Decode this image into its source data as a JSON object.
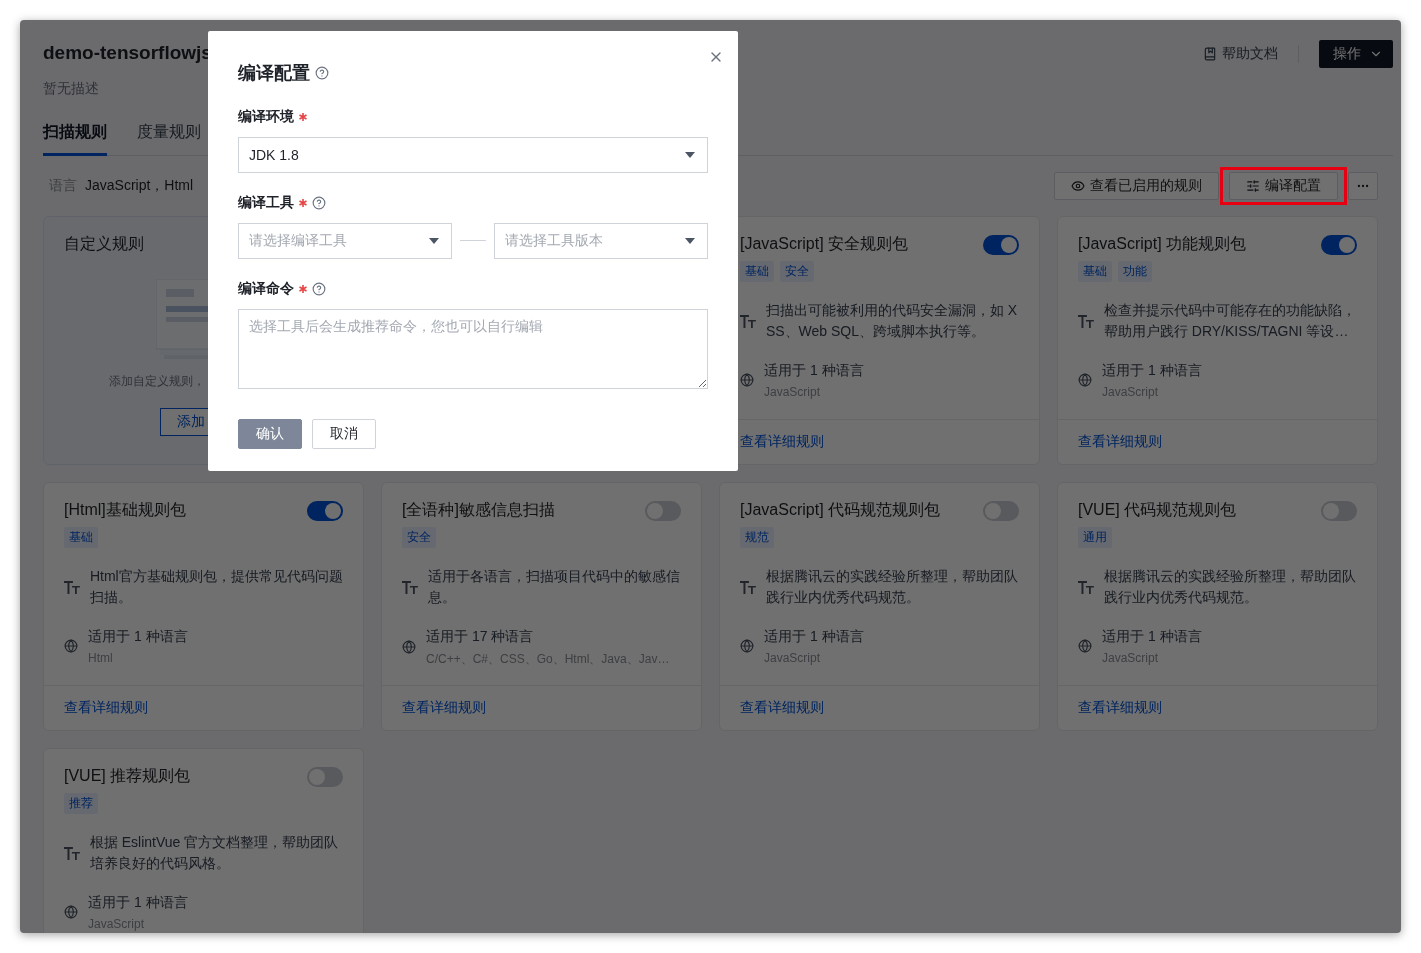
{
  "header": {
    "title": "demo-tensorflowjs",
    "description": "暂无描述",
    "help_link": "帮助文档",
    "actions_button": "操作"
  },
  "tabs": [
    {
      "label": "扫描规则",
      "selected": true
    },
    {
      "label": "度量规则",
      "selected": false
    }
  ],
  "languages": {
    "label": "语言",
    "value": "JavaScript，Html"
  },
  "toolbar": {
    "buttons": [
      {
        "kind": "view",
        "label": "查看已启用的规则",
        "highlighted": false
      },
      {
        "kind": "config",
        "label": "编译配置",
        "highlighted": true
      },
      {
        "kind": "more",
        "highlighted": false
      }
    ]
  },
  "custom_card": {
    "title": "自定义规则",
    "hint": "添加自定义规则，",
    "button": "添加"
  },
  "cards": [
    {
      "title": "[JavaScript] 安全规则包",
      "enabled": true,
      "tags": [
        "基础",
        "安全"
      ],
      "description": "扫描出可能被利用的代码安全漏洞，如 XSS、Web SQL、跨域脚本执行等。",
      "language_count": "适用于 1 种语言",
      "languages": "JavaScript",
      "link": "查看详细规则"
    },
    {
      "title": "[JavaScript] 功能规则包",
      "enabled": true,
      "tags": [
        "基础",
        "功能"
      ],
      "description": "检查并提示代码中可能存在的功能缺陷，帮助用户践行 DRY/KISS/TAGNI 等设…",
      "language_count": "适用于 1 种语言",
      "languages": "JavaScript",
      "link": "查看详细规则"
    },
    {
      "title": "[Html]基础规则包",
      "enabled": true,
      "tags": [
        "基础"
      ],
      "description": "Html官方基础规则包，提供常见代码问题扫描。",
      "language_count": "适用于 1 种语言",
      "languages": "Html",
      "link": "查看详细规则"
    },
    {
      "title": "[全语种]敏感信息扫描",
      "enabled": false,
      "tags": [
        "安全"
      ],
      "description": "适用于各语言，扫描项目代码中的敏感信息。",
      "language_count": "适用于 17 种语言",
      "languages": "C/C++、C#、CSS、Go、Html、Java、Jav…",
      "link": "查看详细规则"
    },
    {
      "title": "[JavaScript] 代码规范规则包",
      "enabled": false,
      "tags": [
        "规范"
      ],
      "description": "根据腾讯云的实践经验所整理，帮助团队践行业内优秀代码规范。",
      "language_count": "适用于 1 种语言",
      "languages": "JavaScript",
      "link": "查看详细规则"
    },
    {
      "title": "[VUE] 代码规范规则包",
      "enabled": false,
      "tags": [
        "通用"
      ],
      "description": "根据腾讯云的实践经验所整理，帮助团队践行业内优秀代码规范。",
      "language_count": "适用于 1 种语言",
      "languages": "JavaScript",
      "link": "查看详细规则"
    },
    {
      "title": "[VUE] 推荐规则包",
      "enabled": false,
      "tags": [
        "推荐"
      ],
      "description": "根据 EslintVue 官方文档整理，帮助团队培养良好的代码风格。",
      "language_count": "适用于 1 种语言",
      "languages": "JavaScript"
    }
  ],
  "modal": {
    "title": "编译配置",
    "fields": [
      {
        "kind": "select",
        "label": "编译环境",
        "required": true,
        "help": false,
        "value": "JDK 1.8"
      },
      {
        "kind": "select_pair",
        "label": "编译工具",
        "required": true,
        "help": true,
        "placeholders": [
          "请选择编译工具",
          "请选择工具版本"
        ]
      },
      {
        "kind": "textarea",
        "label": "编译命令",
        "required": true,
        "help": true,
        "placeholder": "选择工具后会生成推荐命令，您也可以自行编辑"
      }
    ],
    "buttons": [
      {
        "kind": "primary",
        "label": "确认",
        "disabled": true
      },
      {
        "kind": "default",
        "label": "取消",
        "disabled": false
      }
    ]
  }
}
